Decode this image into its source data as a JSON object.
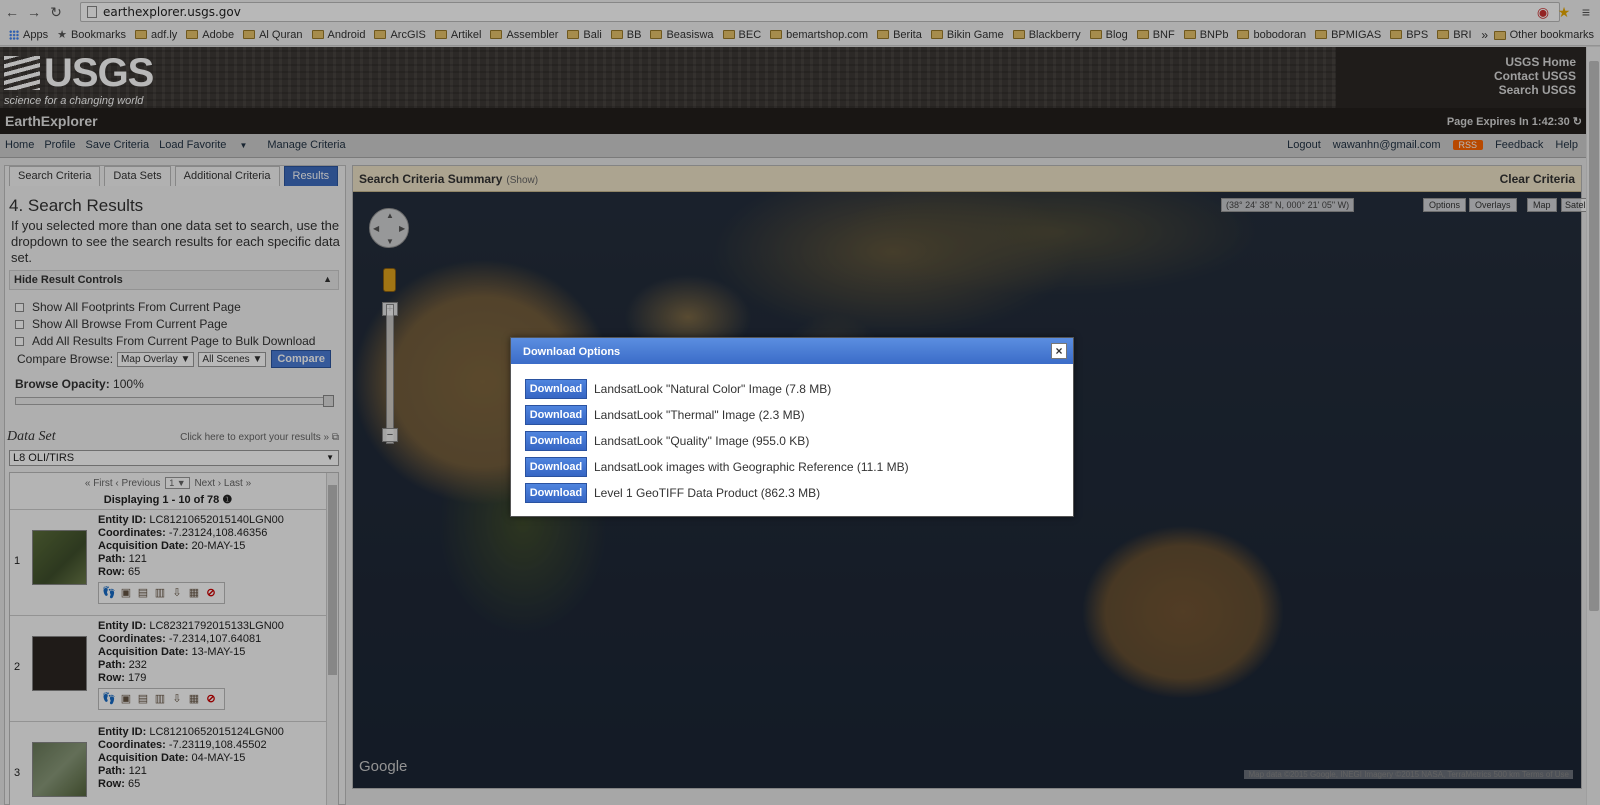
{
  "browser": {
    "url": "earthexplorer.usgs.gov",
    "apps_label": "Apps",
    "bookmarks": [
      "Bookmarks",
      "adf.ly",
      "Adobe",
      "Al Quran",
      "Android",
      "ArcGIS",
      "Artikel",
      "Assembler",
      "Bali",
      "BB",
      "Beasiswa",
      "BEC",
      "bemartshop.com",
      "Berita",
      "Bikin Game",
      "Blackberry",
      "Blog",
      "BNF",
      "BNPb",
      "bobodoran",
      "BPMIGAS",
      "BPS",
      "BRI"
    ],
    "more_label": "»",
    "other_bookmarks": "Other bookmarks"
  },
  "header": {
    "logo_text": "USGS",
    "tagline": "science for a changing world",
    "links": [
      "USGS Home",
      "Contact USGS",
      "Search USGS"
    ]
  },
  "ee": {
    "title": "EarthExplorer",
    "page_expires": "Page Expires In 1:42:30"
  },
  "menu": {
    "left": [
      "Home",
      "Profile",
      "Save Criteria",
      "Load Favorite",
      "Manage Criteria"
    ],
    "right_logout": "Logout",
    "right_email": "wawanhn@gmail.com",
    "right_rss": "RSS",
    "right_feedback": "Feedback",
    "right_help": "Help"
  },
  "left": {
    "tabs": [
      "Search Criteria",
      "Data Sets",
      "Additional Criteria",
      "Results"
    ],
    "results_heading": "4. Search Results",
    "results_desc": "If you selected more than one data set to search, use the dropdown to see the search results for each specific data set.",
    "hide_controls": "Hide Result Controls",
    "checkboxes": [
      "Show All Footprints From Current Page",
      "Show All Browse From Current Page",
      "Add All Results From Current Page to Bulk Download"
    ],
    "compare_label": "Compare Browse:",
    "compare_opt1": "Map Overlay",
    "compare_opt2": "All Scenes",
    "compare_btn": "Compare",
    "opacity_label": "Browse Opacity:",
    "opacity_value": "100%",
    "opacity_level": 1.0,
    "dataset_label": "Data Set",
    "export_link": "Click here to export your results »",
    "dataset_value": "L8 OLI/TIRS",
    "pager_first": "« First",
    "pager_prev": "‹ Previous",
    "pager_page": "1",
    "pager_next": "Next ›",
    "pager_last": "Last »",
    "displaying": "Displaying 1 - 10 of 78"
  },
  "results": [
    {
      "num": "1",
      "entity_label": "Entity ID:",
      "entity": "LC81210652015140LGN00",
      "coord_label": "Coordinates:",
      "coords": "-7.23124,108.46356",
      "acq_label": "Acquisition Date:",
      "acq": "20-MAY-15",
      "path_label": "Path:",
      "path": "121",
      "row_label": "Row:",
      "row": "65"
    },
    {
      "num": "2",
      "entity_label": "Entity ID:",
      "entity": "LC82321792015133LGN00",
      "coord_label": "Coordinates:",
      "coords": "-7.2314,107.64081",
      "acq_label": "Acquisition Date:",
      "acq": "13-MAY-15",
      "path_label": "Path:",
      "path": "232",
      "row_label": "Row:",
      "row": "179"
    },
    {
      "num": "3",
      "entity_label": "Entity ID:",
      "entity": "LC81210652015124LGN00",
      "coord_label": "Coordinates:",
      "coords": "-7.23119,108.45502",
      "acq_label": "Acquisition Date:",
      "acq": "04-MAY-15",
      "path_label": "Path:",
      "path": "121",
      "row_label": "Row:",
      "row": "65"
    }
  ],
  "map": {
    "summary_title": "Search Criteria Summary",
    "summary_show": "(Show)",
    "clear_criteria": "Clear Criteria",
    "coords": "(38° 24' 38\" N, 000° 21' 05\" W)",
    "options_btn": "Options",
    "overlays_btn": "Overlays",
    "map_btn": "Map",
    "satellite_btn": "Satellite",
    "google": "Google",
    "attribution": "Map data ©2015 Google, INEGI Imagery ©2015 NASA, TerraMetrics   500 km   Terms of Use"
  },
  "modal": {
    "title": "Download Options",
    "close": "×",
    "button_label": "Download",
    "options": [
      "LandsatLook \"Natural Color\" Image (7.8 MB)",
      "LandsatLook \"Thermal\" Image (2.3 MB)",
      "LandsatLook \"Quality\" Image (955.0 KB)",
      "LandsatLook images with Geographic Reference (11.1 MB)",
      "Level 1 GeoTIFF Data Product (862.3 MB)"
    ]
  }
}
